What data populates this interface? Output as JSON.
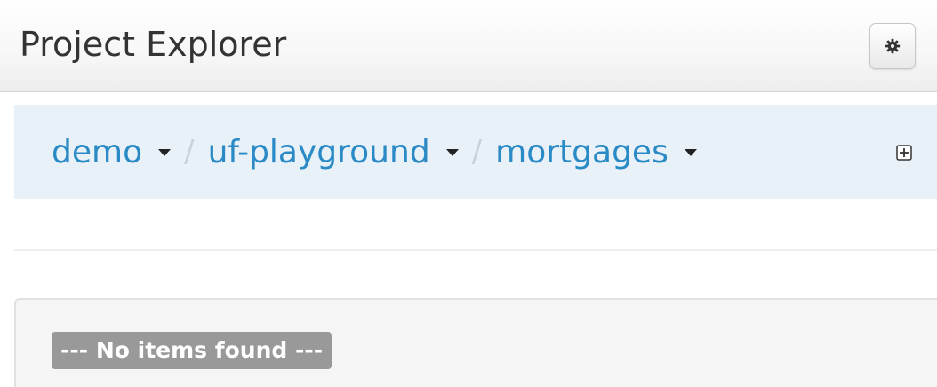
{
  "header": {
    "title": "Project Explorer",
    "settings_icon": "gear-icon"
  },
  "breadcrumb": {
    "items": [
      {
        "label": "demo",
        "has_dropdown": true
      },
      {
        "label": "uf-playground",
        "has_dropdown": true
      },
      {
        "label": "mortgages",
        "has_dropdown": true
      }
    ],
    "separator": "/",
    "link_color": "#2a8ac5",
    "add_icon": "plus-square-icon"
  },
  "items_panel": {
    "empty_message": "--- No items found ---"
  }
}
